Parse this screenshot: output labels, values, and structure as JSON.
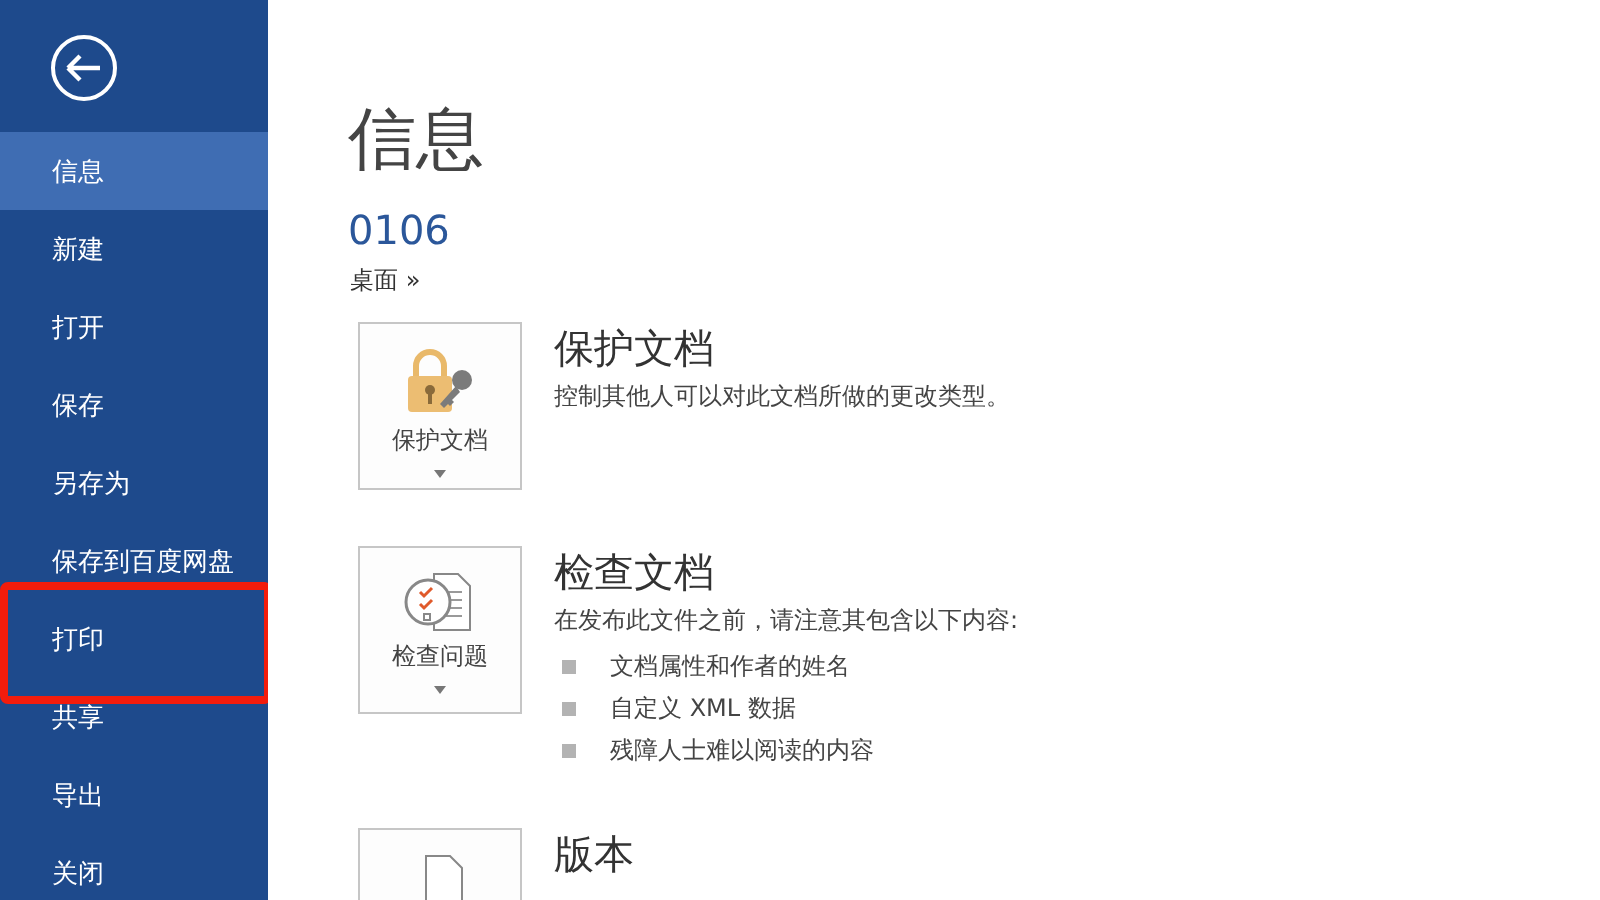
{
  "sidebar": {
    "items": [
      {
        "label": "信息",
        "selected": true,
        "highlighted": false
      },
      {
        "label": "新建",
        "selected": false,
        "highlighted": false
      },
      {
        "label": "打开",
        "selected": false,
        "highlighted": false
      },
      {
        "label": "保存",
        "selected": false,
        "highlighted": false
      },
      {
        "label": "另存为",
        "selected": false,
        "highlighted": false
      },
      {
        "label": "保存到百度网盘",
        "selected": false,
        "highlighted": false
      },
      {
        "label": "打印",
        "selected": false,
        "highlighted": true
      },
      {
        "label": "共享",
        "selected": false,
        "highlighted": false
      },
      {
        "label": "导出",
        "selected": false,
        "highlighted": false
      },
      {
        "label": "关闭",
        "selected": false,
        "highlighted": false
      }
    ]
  },
  "page_title": "信息",
  "document_name": "0106",
  "location": "桌面 »",
  "sections": [
    {
      "kind": "protect",
      "button_label": "保护文档",
      "title": "保护文档",
      "description": "控制其他人可以对此文档所做的更改类型。"
    },
    {
      "kind": "inspect",
      "button_label": "检查问题",
      "title": "检查文档",
      "description": "在发布此文件之前，请注意其包含以下内容:",
      "bullets": [
        "文档属性和作者的姓名",
        "自定义 XML 数据",
        "残障人士难以阅读的内容"
      ]
    },
    {
      "kind": "versions",
      "title": "版本"
    }
  ]
}
